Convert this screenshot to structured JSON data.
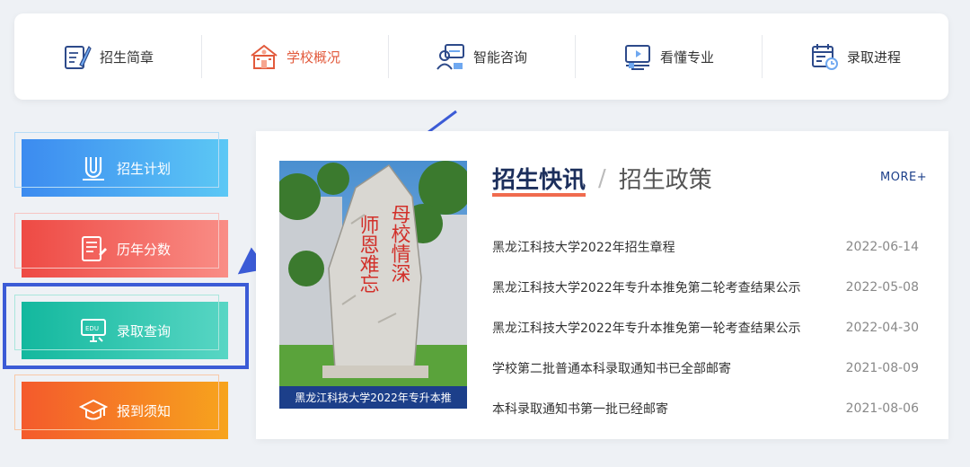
{
  "top_nav": [
    {
      "label": "招生简章",
      "icon": "brochure-icon",
      "active": false
    },
    {
      "label": "学校概况",
      "icon": "school-building-icon",
      "active": true
    },
    {
      "label": "智能咨询",
      "icon": "consult-icon",
      "active": false
    },
    {
      "label": "看懂专业",
      "icon": "major-video-icon",
      "active": false
    },
    {
      "label": "录取进程",
      "icon": "calendar-clock-icon",
      "active": false
    }
  ],
  "side_buttons": [
    {
      "label": "招生计划",
      "icon": "magnet-plan-icon"
    },
    {
      "label": "历年分数",
      "icon": "score-sheet-icon"
    },
    {
      "label": "录取查询",
      "icon": "edu-query-icon"
    },
    {
      "label": "报到须知",
      "icon": "graduation-cap-icon"
    }
  ],
  "news": {
    "photo_caption": "黑龙江科技大学2022年专升本推",
    "stone_text_right": "母校情深",
    "stone_text_left": "师恩难忘",
    "tab_active": "招生快讯",
    "tab_separator": "/",
    "tab_other": "招生政策",
    "more": "MORE+",
    "items": [
      {
        "title": "黑龙江科技大学2022年招生章程",
        "date": "2022-06-14"
      },
      {
        "title": "黑龙江科技大学2022年专升本推免第二轮考查结果公示",
        "date": "2022-05-08"
      },
      {
        "title": "黑龙江科技大学2022年专升本推免第一轮考查结果公示",
        "date": "2022-04-30"
      },
      {
        "title": "学校第二批普通本科录取通知书已全部邮寄",
        "date": "2021-08-09"
      },
      {
        "title": "本科录取通知书第一批已经邮寄",
        "date": "2021-08-06"
      }
    ]
  },
  "colors": {
    "accent_red": "#e25a3c",
    "annotation_blue": "#3b5bd6",
    "caption_bg": "#1c3f8a"
  }
}
